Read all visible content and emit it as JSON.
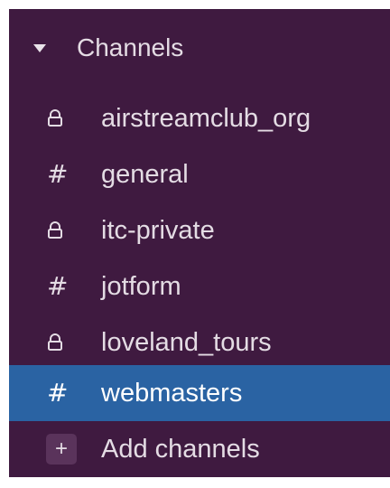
{
  "section": {
    "title": "Channels",
    "caret_icon": "caret-down-icon"
  },
  "channels": [
    {
      "name": "airstreamclub_org",
      "icon": "lock-icon",
      "private": true
    },
    {
      "name": "general",
      "icon": "hash-icon",
      "private": false
    },
    {
      "name": "itc-private",
      "icon": "lock-icon",
      "private": true
    },
    {
      "name": "jotform",
      "icon": "hash-icon",
      "private": false
    },
    {
      "name": "loveland_tours",
      "icon": "lock-icon",
      "private": true
    },
    {
      "name": "webmasters",
      "icon": "hash-icon",
      "private": false,
      "active": true
    }
  ],
  "add_channels": {
    "label": "Add channels",
    "icon": "plus-icon"
  },
  "colors": {
    "sidebar_bg": "#3f1a40",
    "active_bg": "#2a63a3",
    "text": "#e4dce4"
  }
}
